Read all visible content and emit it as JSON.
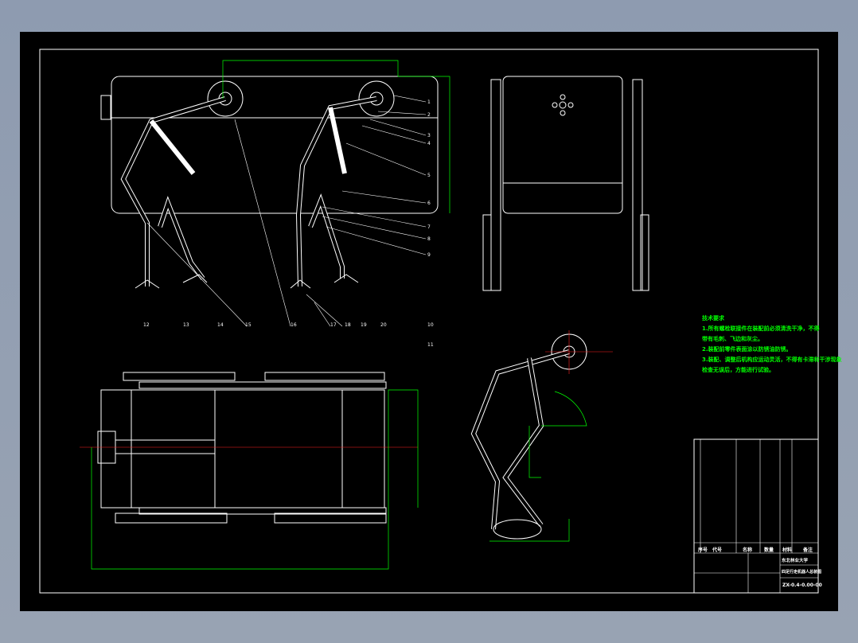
{
  "drawing": {
    "technical_requirements": {
      "title": "技术要求",
      "items": [
        "1.所有螺栓联接件在装配前必须清洗干净，不得",
        "带有毛刺、飞边和灰尘。",
        "2.装配前零件表面涂以防锈油防锈。",
        "3.装配、调整后机构应运动灵活，不得有卡滞和干涉现象",
        "检查无误后，方能进行试验。"
      ]
    },
    "title_block": {
      "school": "东北林业大学",
      "drawing_name": "四足行走机器人总装图",
      "drawing_number": "ZX-0.4-0.00-00",
      "headers": [
        "序号",
        "代号",
        "名称",
        "数量",
        "材料",
        "备注"
      ]
    },
    "balloons_right": [
      "1",
      "2",
      "3",
      "4",
      "5",
      "6",
      "7",
      "8",
      "9"
    ],
    "balloons_bottom": [
      "12",
      "13",
      "14",
      "15",
      "16",
      "17",
      "18",
      "19",
      "20",
      "10",
      "11"
    ],
    "colors": {
      "background": "#000000",
      "lines": "#ffffff",
      "dimensions": "#00ff00",
      "centerlines": "#ff0000",
      "window": "#8e9bb0"
    }
  }
}
